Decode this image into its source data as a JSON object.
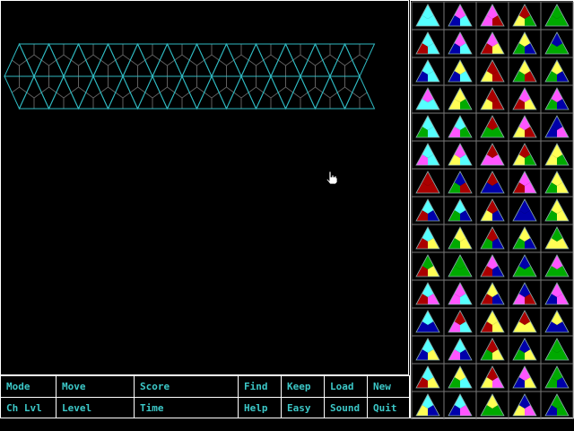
{
  "menu": {
    "row1": [
      "Mode",
      "Move",
      "Score",
      "Find",
      "Keep",
      "Load",
      "New"
    ],
    "row2": [
      "Ch Lvl",
      "Level",
      "Time",
      "Help",
      "Easy",
      "Sound",
      "Quit"
    ]
  },
  "board": {
    "rows": 2,
    "triangles_per_row": 24,
    "outline_color": "#2fb8c0",
    "inner_line_color": "#606060"
  },
  "tray": {
    "rows": 15,
    "cols": 5,
    "palette": {
      "C": "#55ffff",
      "R": "#aa0000",
      "B": "#0000aa",
      "M": "#ff55ff",
      "Y": "#ffff55",
      "G": "#00aa00"
    },
    "pieces": [
      [
        "CCC",
        "MBC",
        "MMR",
        "RYG",
        "GGG"
      ],
      [
        "CRC",
        "MBC",
        "MRY",
        "YGB",
        "BGG"
      ],
      [
        "CBC",
        "YBC",
        "RYR",
        "YGR",
        "YGB"
      ],
      [
        "MCC",
        "YYG",
        "RYR",
        "MRY",
        "MGB"
      ],
      [
        "CGC",
        "CMG",
        "RGG",
        "MYR",
        "BBM"
      ],
      [
        "CMC",
        "MYC",
        "RMM",
        "RYG",
        "YYG"
      ],
      [
        "RRR",
        "BGR",
        "RBB",
        "MRM",
        "YGY"
      ],
      [
        "CRB",
        "CGB",
        "RYB",
        "BBB",
        "YGY"
      ],
      [
        "CRY",
        "YGY",
        "RGB",
        "YGB",
        "GYY"
      ],
      [
        "GRY",
        "GGG",
        "MRB",
        "BGG",
        "MGG"
      ],
      [
        "CRM",
        "MMC",
        "YRB",
        "BMR",
        "MBM"
      ],
      [
        "CBB",
        "RMC",
        "YRY",
        "RYY",
        "YBB"
      ],
      [
        "CBY",
        "CMB",
        "RGY",
        "BGY",
        "GGG"
      ],
      [
        "CRY",
        "YGC",
        "RYM",
        "MBY",
        "GGB"
      ],
      [
        "CYB",
        "CBM",
        "YGG",
        "BYM",
        "GBG"
      ]
    ]
  }
}
